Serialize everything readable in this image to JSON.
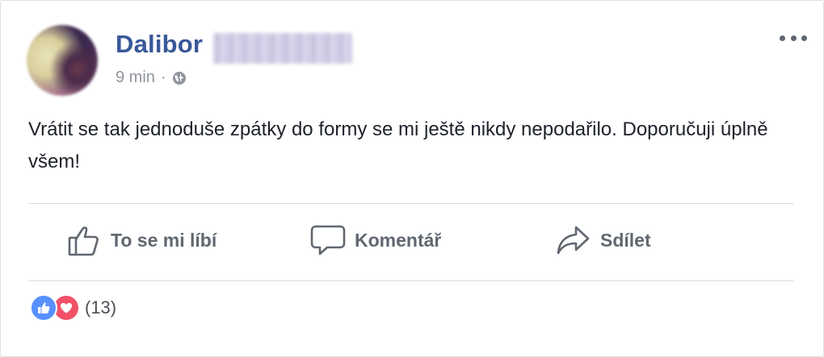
{
  "post": {
    "author_first_name": "Dalibor",
    "time": "9 min",
    "separator": "·",
    "privacy_icon": "globe-icon",
    "text": "Vrátit se tak jednoduše zpátky do formy se mi ještě nikdy nepodařilo. Doporučuji úplně všem!"
  },
  "actions": {
    "like_label": "To se mi líbí",
    "comment_label": "Komentář",
    "share_label": "Sdílet"
  },
  "reactions": {
    "types": [
      "like-icon",
      "love-icon"
    ],
    "count": "(13)"
  },
  "colors": {
    "author": "#385898",
    "muted": "#90949c",
    "action": "#606770",
    "like": "#5890ff",
    "love": "#f25268"
  }
}
